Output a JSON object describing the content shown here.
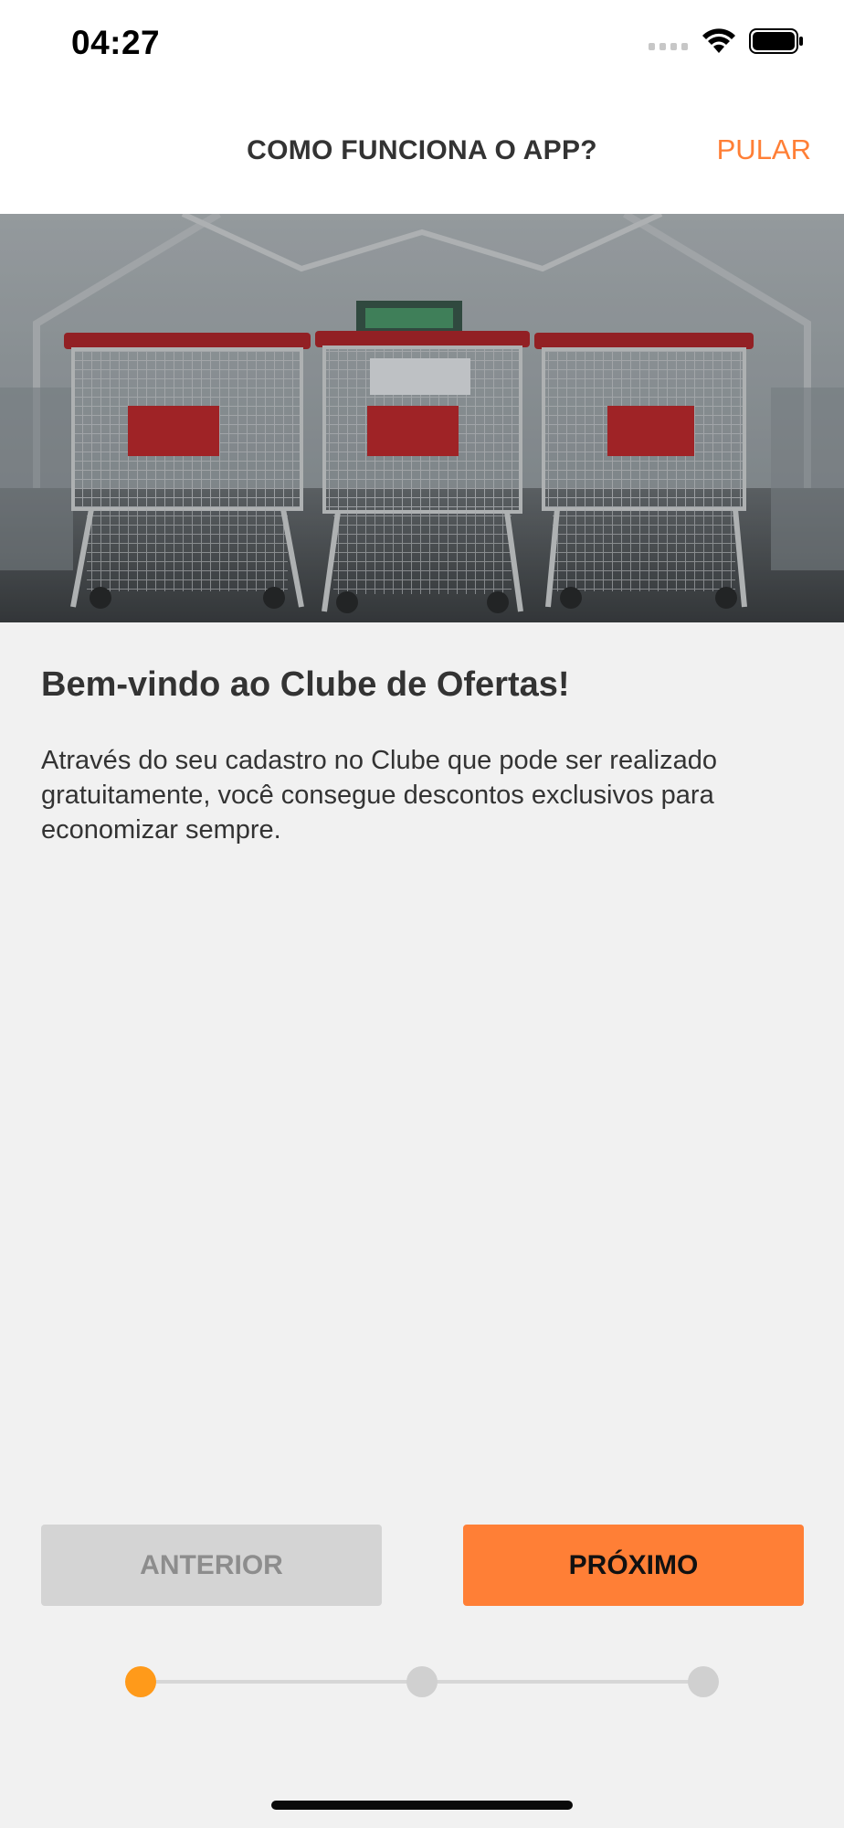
{
  "status_bar": {
    "time": "04:27",
    "icons": [
      "signal-icon",
      "wifi-icon",
      "battery-icon"
    ]
  },
  "header": {
    "title": "COMO FUNCIONA O APP?",
    "skip_label": "PULAR"
  },
  "hero": {
    "image": "shopping-carts-photo"
  },
  "content": {
    "title": "Bem-vindo ao Clube de Ofertas!",
    "text": "Através do seu cadastro no Clube que pode ser realizado gratuitamente, você consegue descontos exclusivos para economizar sempre."
  },
  "buttons": {
    "previous_label": "ANTERIOR",
    "next_label": "PRÓXIMO"
  },
  "stepper": {
    "total_steps": 3,
    "current_step": 1
  },
  "colors": {
    "accent": "#ff7f36",
    "active_step": "#ff9a1a",
    "background": "#f1f1f1"
  }
}
